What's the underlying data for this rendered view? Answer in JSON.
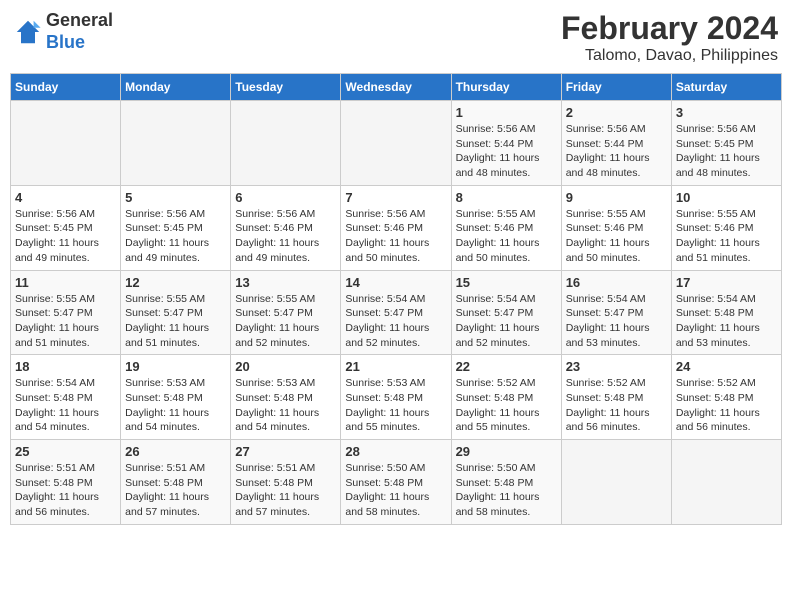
{
  "logo": {
    "line1": "General",
    "line2": "Blue"
  },
  "title": "February 2024",
  "subtitle": "Talomo, Davao, Philippines",
  "days_of_week": [
    "Sunday",
    "Monday",
    "Tuesday",
    "Wednesday",
    "Thursday",
    "Friday",
    "Saturday"
  ],
  "weeks": [
    [
      {
        "day": "",
        "info": ""
      },
      {
        "day": "",
        "info": ""
      },
      {
        "day": "",
        "info": ""
      },
      {
        "day": "",
        "info": ""
      },
      {
        "day": "1",
        "info": "Sunrise: 5:56 AM\nSunset: 5:44 PM\nDaylight: 11 hours and 48 minutes."
      },
      {
        "day": "2",
        "info": "Sunrise: 5:56 AM\nSunset: 5:44 PM\nDaylight: 11 hours and 48 minutes."
      },
      {
        "day": "3",
        "info": "Sunrise: 5:56 AM\nSunset: 5:45 PM\nDaylight: 11 hours and 48 minutes."
      }
    ],
    [
      {
        "day": "4",
        "info": "Sunrise: 5:56 AM\nSunset: 5:45 PM\nDaylight: 11 hours and 49 minutes."
      },
      {
        "day": "5",
        "info": "Sunrise: 5:56 AM\nSunset: 5:45 PM\nDaylight: 11 hours and 49 minutes."
      },
      {
        "day": "6",
        "info": "Sunrise: 5:56 AM\nSunset: 5:46 PM\nDaylight: 11 hours and 49 minutes."
      },
      {
        "day": "7",
        "info": "Sunrise: 5:56 AM\nSunset: 5:46 PM\nDaylight: 11 hours and 50 minutes."
      },
      {
        "day": "8",
        "info": "Sunrise: 5:55 AM\nSunset: 5:46 PM\nDaylight: 11 hours and 50 minutes."
      },
      {
        "day": "9",
        "info": "Sunrise: 5:55 AM\nSunset: 5:46 PM\nDaylight: 11 hours and 50 minutes."
      },
      {
        "day": "10",
        "info": "Sunrise: 5:55 AM\nSunset: 5:46 PM\nDaylight: 11 hours and 51 minutes."
      }
    ],
    [
      {
        "day": "11",
        "info": "Sunrise: 5:55 AM\nSunset: 5:47 PM\nDaylight: 11 hours and 51 minutes."
      },
      {
        "day": "12",
        "info": "Sunrise: 5:55 AM\nSunset: 5:47 PM\nDaylight: 11 hours and 51 minutes."
      },
      {
        "day": "13",
        "info": "Sunrise: 5:55 AM\nSunset: 5:47 PM\nDaylight: 11 hours and 52 minutes."
      },
      {
        "day": "14",
        "info": "Sunrise: 5:54 AM\nSunset: 5:47 PM\nDaylight: 11 hours and 52 minutes."
      },
      {
        "day": "15",
        "info": "Sunrise: 5:54 AM\nSunset: 5:47 PM\nDaylight: 11 hours and 52 minutes."
      },
      {
        "day": "16",
        "info": "Sunrise: 5:54 AM\nSunset: 5:47 PM\nDaylight: 11 hours and 53 minutes."
      },
      {
        "day": "17",
        "info": "Sunrise: 5:54 AM\nSunset: 5:48 PM\nDaylight: 11 hours and 53 minutes."
      }
    ],
    [
      {
        "day": "18",
        "info": "Sunrise: 5:54 AM\nSunset: 5:48 PM\nDaylight: 11 hours and 54 minutes."
      },
      {
        "day": "19",
        "info": "Sunrise: 5:53 AM\nSunset: 5:48 PM\nDaylight: 11 hours and 54 minutes."
      },
      {
        "day": "20",
        "info": "Sunrise: 5:53 AM\nSunset: 5:48 PM\nDaylight: 11 hours and 54 minutes."
      },
      {
        "day": "21",
        "info": "Sunrise: 5:53 AM\nSunset: 5:48 PM\nDaylight: 11 hours and 55 minutes."
      },
      {
        "day": "22",
        "info": "Sunrise: 5:52 AM\nSunset: 5:48 PM\nDaylight: 11 hours and 55 minutes."
      },
      {
        "day": "23",
        "info": "Sunrise: 5:52 AM\nSunset: 5:48 PM\nDaylight: 11 hours and 56 minutes."
      },
      {
        "day": "24",
        "info": "Sunrise: 5:52 AM\nSunset: 5:48 PM\nDaylight: 11 hours and 56 minutes."
      }
    ],
    [
      {
        "day": "25",
        "info": "Sunrise: 5:51 AM\nSunset: 5:48 PM\nDaylight: 11 hours and 56 minutes."
      },
      {
        "day": "26",
        "info": "Sunrise: 5:51 AM\nSunset: 5:48 PM\nDaylight: 11 hours and 57 minutes."
      },
      {
        "day": "27",
        "info": "Sunrise: 5:51 AM\nSunset: 5:48 PM\nDaylight: 11 hours and 57 minutes."
      },
      {
        "day": "28",
        "info": "Sunrise: 5:50 AM\nSunset: 5:48 PM\nDaylight: 11 hours and 58 minutes."
      },
      {
        "day": "29",
        "info": "Sunrise: 5:50 AM\nSunset: 5:48 PM\nDaylight: 11 hours and 58 minutes."
      },
      {
        "day": "",
        "info": ""
      },
      {
        "day": "",
        "info": ""
      }
    ]
  ]
}
